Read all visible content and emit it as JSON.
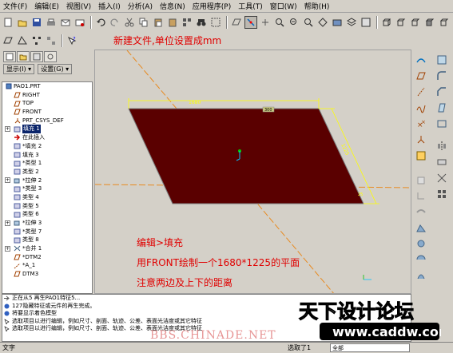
{
  "menu": [
    "文件(F)",
    "编辑(E)",
    "视图(V)",
    "插入(I)",
    "分析(A)",
    "信息(N)",
    "应用程序(P)",
    "工具(T)",
    "窗口(W)",
    "帮助(H)"
  ],
  "left_tabs": {
    "show_label": "显示(I) ▾",
    "settings_label": "设置(G) ▾"
  },
  "model_tree": [
    {
      "label": "PAO1.PRT",
      "icon": "part-icon",
      "indent": 0
    },
    {
      "label": "RIGHT",
      "icon": "datum-plane-icon",
      "indent": 1
    },
    {
      "label": "TOP",
      "icon": "datum-plane-icon",
      "indent": 1
    },
    {
      "label": "FRONT",
      "icon": "datum-plane-icon",
      "indent": 1
    },
    {
      "label": "PRT_CSYS_DEF",
      "icon": "csys-icon",
      "indent": 1
    },
    {
      "label": "填充 1",
      "icon": "fill-icon",
      "indent": 1,
      "selected": true,
      "expand": "+"
    },
    {
      "label": "在此插入",
      "icon": "insert-arrow-icon",
      "indent": 1
    },
    {
      "label": "*填充 2",
      "icon": "fill-icon",
      "indent": 1
    },
    {
      "label": "填充 3",
      "icon": "fill-icon",
      "indent": 1
    },
    {
      "label": "*类型 1",
      "icon": "feature-icon",
      "indent": 1
    },
    {
      "label": "类型 2",
      "icon": "feature-icon",
      "indent": 1
    },
    {
      "label": "*拉伸 2",
      "icon": "extrude-icon",
      "indent": 1,
      "expand": "+"
    },
    {
      "label": "*类型 3",
      "icon": "feature-icon",
      "indent": 1
    },
    {
      "label": "类型 4",
      "icon": "feature-icon",
      "indent": 1
    },
    {
      "label": "类型 5",
      "icon": "feature-icon",
      "indent": 1
    },
    {
      "label": "类型 6",
      "icon": "feature-icon",
      "indent": 1
    },
    {
      "label": "*拉伸 3",
      "icon": "extrude-icon",
      "indent": 1,
      "expand": "+"
    },
    {
      "label": "*类型 7",
      "icon": "feature-icon",
      "indent": 1
    },
    {
      "label": "类型 8",
      "icon": "feature-icon",
      "indent": 1
    },
    {
      "label": "*合并 1",
      "icon": "merge-icon",
      "indent": 1,
      "expand": "+"
    },
    {
      "label": "*DTM2",
      "icon": "datum-plane-icon",
      "indent": 1
    },
    {
      "label": "*A_1",
      "icon": "axis-icon",
      "indent": 1
    },
    {
      "label": "DTM3",
      "icon": "datum-plane-icon",
      "indent": 1
    }
  ],
  "annotations": {
    "top_note": "新建文件,单位设置成mm",
    "note_1": "编辑>填充",
    "note_2": "用FRONT绘制一个1680*1225的平面",
    "note_3": "注意两边及上下的距离"
  },
  "dimensions": {
    "width": "1680",
    "height": "1225",
    "small_top": "300",
    "small_side": "25"
  },
  "messages": [
    {
      "text": "正在从5 再生PAO1特征5...",
      "icon": "arrow-icon"
    },
    {
      "text": "127隐藏特征或元件的再生完成。",
      "icon": "info-icon"
    },
    {
      "text": "将要显示着色模型",
      "icon": "info-icon"
    },
    {
      "text": "选取项目以进行编辑，例如尺寸、剖面、轨迹、公差、表面光洁度或其它特征",
      "icon": "select-icon"
    },
    {
      "text": "选取项目以进行编辑，例如尺寸、剖面、轨迹、公差、表面光洁度或其它特征",
      "icon": "select-icon"
    }
  ],
  "status": {
    "left_text": "文字",
    "filter_label": "选取了1",
    "filter_value": "全部"
  },
  "brand": {
    "logo_text": "天下设计论坛",
    "logo_url_text": "www.caddw.com",
    "watermark": "BBS.CHINADE.NET"
  },
  "colors": {
    "fill_plane": "#5a0000",
    "plane_edge": "#7a7a7a",
    "yellow_dim": "#ffff00",
    "datum_orange": "#e88a20",
    "annotation_text": "#e00000",
    "accent_red": "#e01010"
  }
}
